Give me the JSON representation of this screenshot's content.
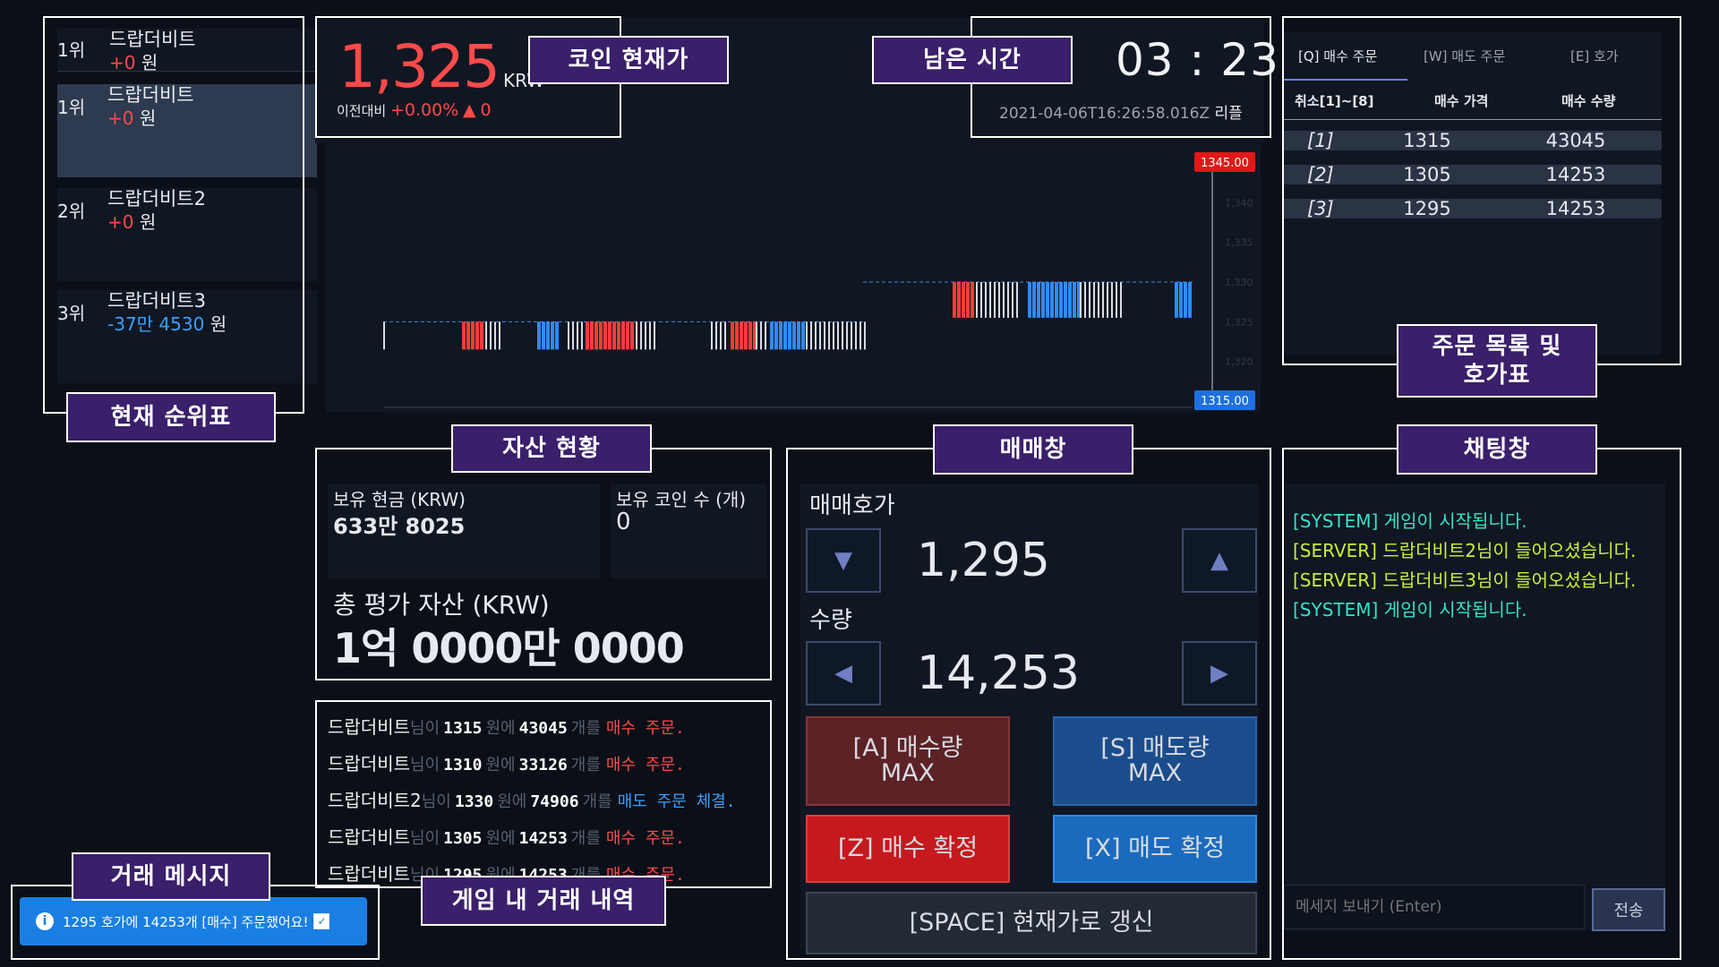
{
  "ranking": {
    "pinned": {
      "rank": "1위",
      "name": "드랍더비트",
      "delta": "+0",
      "unit": "원"
    },
    "items": [
      {
        "rank": "1위",
        "name": "드랍더비트",
        "delta": "+0",
        "unit": "원"
      },
      {
        "rank": "2위",
        "name": "드랍더비트2",
        "delta": "+0",
        "unit": "원"
      },
      {
        "rank": "3위",
        "name": "드랍더비트3",
        "delta": "-37만 4530",
        "unit": "원"
      }
    ]
  },
  "price": {
    "value": "1,325",
    "currency": "KRW",
    "change_label": "이전대비",
    "change_pct": "+0.00%",
    "change_arrow": "▲",
    "change_abs": "0"
  },
  "timer": {
    "value": "03 : 23",
    "timestamp": "2021-04-06T16:26:58.016Z",
    "timestamp_suffix": "리플"
  },
  "chart_data": {
    "type": "bar",
    "ylim": [
      1315,
      1345
    ],
    "high_label": "1345.00",
    "low_label": "1315.00",
    "ticks": [
      "1,340",
      "1,335",
      "1,330",
      "1,325",
      "1,320"
    ],
    "colors": {
      "buy": "#ff3b3b",
      "sell": "#2f8bff",
      "neutral": "#d8dbe2"
    }
  },
  "orderbook": {
    "tabs": [
      "[Q] 매수 주문",
      "[W] 매도 주문",
      "[E] 호가"
    ],
    "header": [
      "취소[1]~[8]",
      "매수 가격",
      "매수 수량"
    ],
    "rows": [
      {
        "key": "[1]",
        "price": "1315",
        "qty": "43045"
      },
      {
        "key": "[2]",
        "price": "1305",
        "qty": "14253"
      },
      {
        "key": "[3]",
        "price": "1295",
        "qty": "14253"
      }
    ]
  },
  "assets": {
    "cash_label": "보유 현금 (KRW)",
    "cash_value": "633만 8025",
    "coin_label": "보유 코인 수 (개)",
    "coin_value": "0",
    "total_label": "총 평가 자산 (KRW)",
    "total_value": "1억 0000만 0000"
  },
  "trade": {
    "price_label": "매매호가",
    "price_value": "1,295",
    "qty_label": "수량",
    "qty_value": "14,253",
    "buy_max": [
      "[A] 매수량",
      "MAX"
    ],
    "sell_max": [
      "[S] 매도량",
      "MAX"
    ],
    "buy_confirm": "[Z] 매수 확정",
    "sell_confirm": "[X] 매도 확정",
    "refresh": "[SPACE] 현재가로 갱신"
  },
  "history": [
    {
      "name": "드랍더비트",
      "p1": "님이",
      "price": "1315",
      "p2": "원에",
      "qty": "43045",
      "p3": "개를",
      "action": "매수 주문.",
      "kind": "buy"
    },
    {
      "name": "드랍더비트",
      "p1": "님이",
      "price": "1310",
      "p2": "원에",
      "qty": "33126",
      "p3": "개를",
      "action": "매수 주문.",
      "kind": "buy"
    },
    {
      "name": "드랍더비트2",
      "p1": "님이",
      "price": "1330",
      "p2": "원에",
      "qty": "74906",
      "p3": "개를",
      "action": "매도 주문 체결.",
      "kind": "sell"
    },
    {
      "name": "드랍더비트",
      "p1": "님이",
      "price": "1305",
      "p2": "원에",
      "qty": "14253",
      "p3": "개를",
      "action": "매수 주문.",
      "kind": "buy"
    },
    {
      "name": "드랍더비트",
      "p1": "님이",
      "price": "1295",
      "p2": "원에",
      "qty": "14253",
      "p3": "개를",
      "action": "매수 주문.",
      "kind": "buy"
    }
  ],
  "chat": {
    "messages": [
      {
        "text": "[SYSTEM] 게임이 시작됩니다.",
        "color": "#38e0c8"
      },
      {
        "text": "[SERVER] 드랍더비트2님이 들어오셨습니다.",
        "color": "#c6f03a"
      },
      {
        "text": "[SERVER] 드랍더비트3님이 들어오셨습니다.",
        "color": "#c6f03a"
      },
      {
        "text": "[SYSTEM] 게임이 시작됩니다.",
        "color": "#38e0c8"
      }
    ],
    "placeholder": "메세지 보내기 (Enter)",
    "send": "전송"
  },
  "toast": {
    "text": "1295 호가에 14253개 [매수] 주문했어요!",
    "icon": "info-icon"
  },
  "callouts": {
    "coin_price": "코인 현재가",
    "time_left": "남은 시간",
    "ranking": "현재 순위표",
    "assets": "자산 현황",
    "trade": "매매창",
    "chat": "채팅창",
    "orderbook": "주문 목록 및\n호가표",
    "history": "게임 내 거래 내역",
    "trade_msg": "거래 메시지"
  }
}
